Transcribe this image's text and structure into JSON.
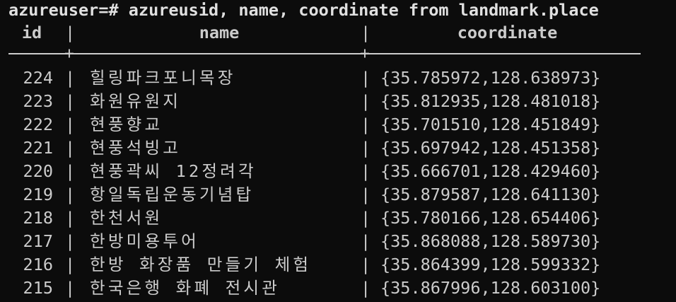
{
  "terminal": {
    "command_line": "azureuser=# azureusid, name, coordinate from landmark.place",
    "headers": {
      "id": "id",
      "name": "name",
      "coordinate": "coordinate"
    },
    "separator_char": "|",
    "cross_char": "+",
    "rows": [
      {
        "id": "224",
        "name": "힐링파크포니목장",
        "coordinate": "{35.785972,128.638973}"
      },
      {
        "id": "223",
        "name": "화원유원지",
        "coordinate": "{35.812935,128.481018}"
      },
      {
        "id": "222",
        "name": "현풍향교",
        "coordinate": "{35.701510,128.451849}"
      },
      {
        "id": "221",
        "name": "현풍석빙고",
        "coordinate": "{35.697942,128.451358}"
      },
      {
        "id": "220",
        "name": "현풍곽씨 12정려각",
        "coordinate": "{35.666701,128.429460}"
      },
      {
        "id": "219",
        "name": "항일독립운동기념탑",
        "coordinate": "{35.879587,128.641130}"
      },
      {
        "id": "218",
        "name": "한천서원",
        "coordinate": "{35.780166,128.654406}"
      },
      {
        "id": "217",
        "name": "한방미용투어",
        "coordinate": "{35.868088,128.589730}"
      },
      {
        "id": "216",
        "name": "한방 화장품 만들기 체험",
        "coordinate": "{35.864399,128.599332}"
      },
      {
        "id": "215",
        "name": "한국은행 화폐 전시관",
        "coordinate": "{35.867996,128.603100}"
      }
    ]
  }
}
